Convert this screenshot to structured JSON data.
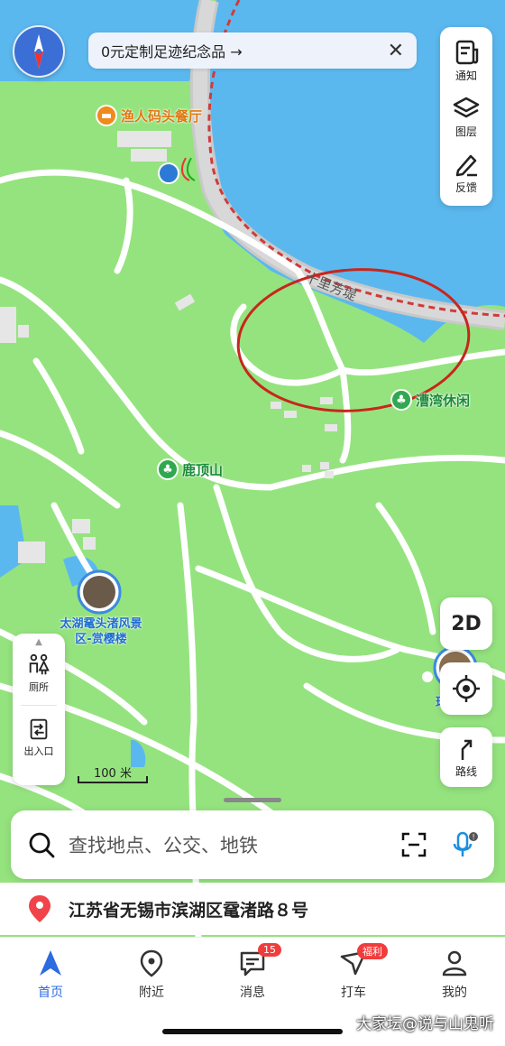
{
  "banner": {
    "text": "0元定制足迹纪念品 →",
    "close": "✕"
  },
  "tools": {
    "notice": "通知",
    "layers": "图层",
    "feedback": "反馈"
  },
  "pois": {
    "restaurant": "渔人码头餐厅",
    "road": "十里芳堤",
    "bay": "漕湾休闲",
    "mountain": "鹿顶山",
    "scenic": "太湖鼋头渚风景区-赏樱楼"
  },
  "controls": {
    "mode_2d": "2D",
    "route": "路线",
    "toilet": "厕所",
    "entrance": "出入口"
  },
  "scale": "100 米",
  "search": {
    "placeholder": "查找地点、公交、地铁"
  },
  "address": "江苏省无锡市滨湖区鼋渚路８号",
  "tabs": [
    {
      "label": "首页",
      "icon": "navigation-arrow-icon"
    },
    {
      "label": "附近",
      "icon": "location-pin-icon"
    },
    {
      "label": "消息",
      "icon": "message-icon",
      "badge": "15"
    },
    {
      "label": "打车",
      "icon": "taxi-icon",
      "badge": "福利"
    },
    {
      "label": "我的",
      "icon": "person-icon"
    }
  ],
  "watermark": "大家坛@说与山鬼听",
  "colors": {
    "accent": "#2c6be0",
    "water": "#5bb8ef",
    "land": "#95e37f",
    "badge": "#f23c3c"
  }
}
